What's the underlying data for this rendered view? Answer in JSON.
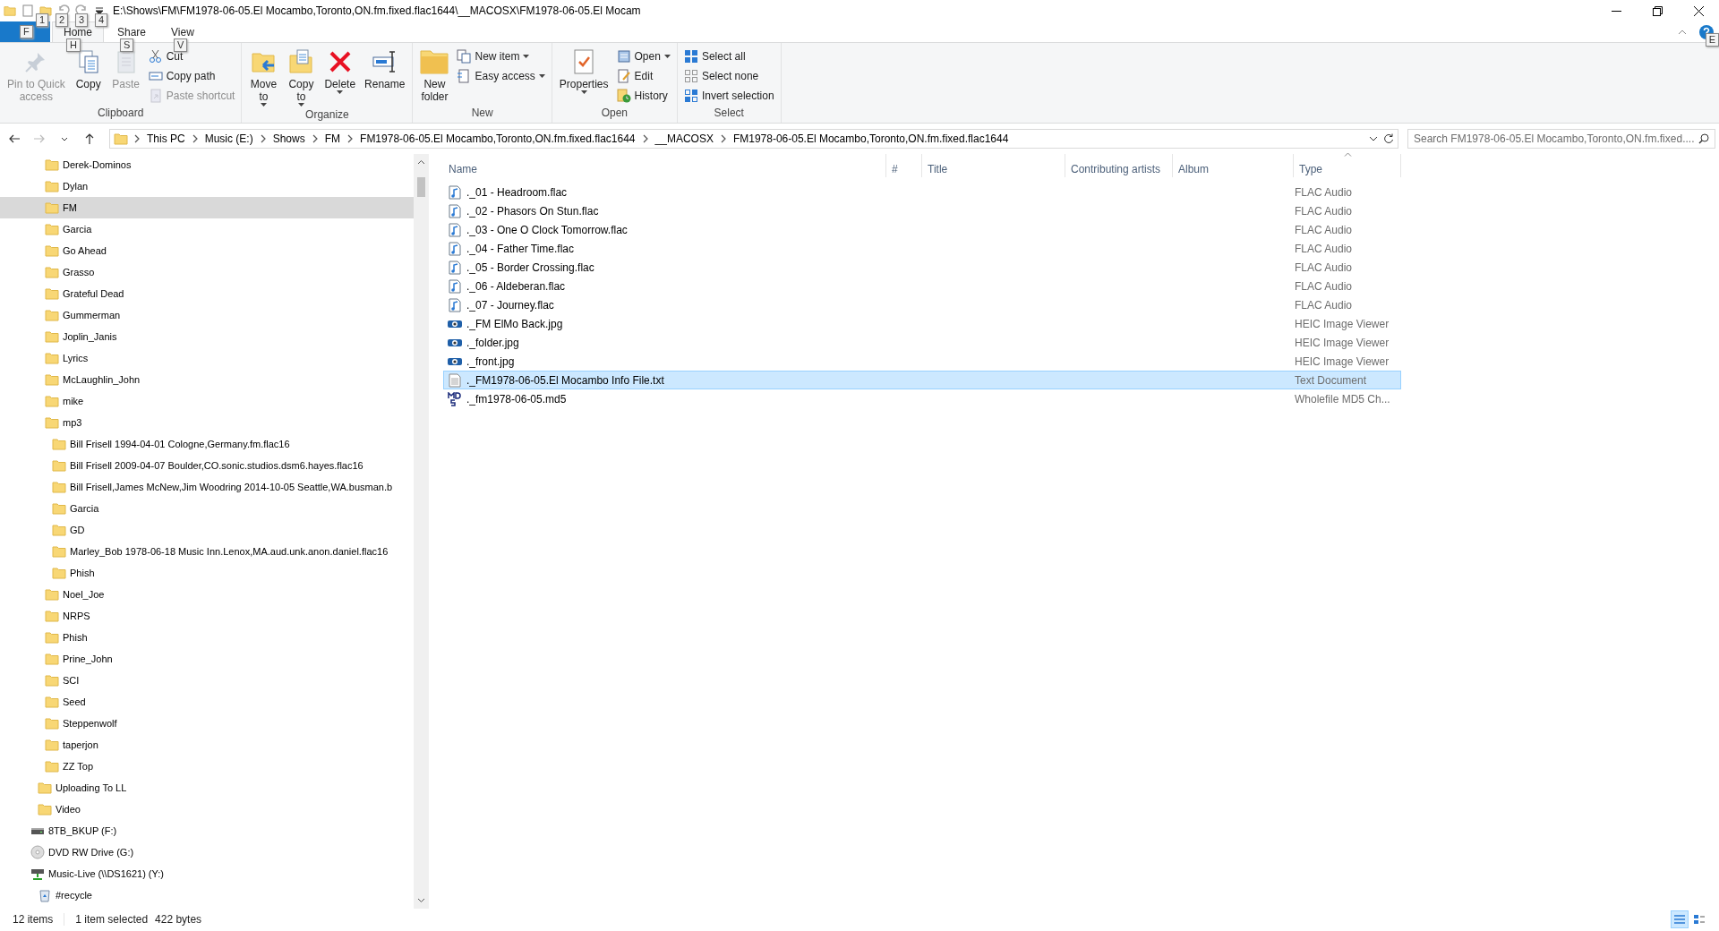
{
  "window": {
    "title": "E:\\Shows\\FM\\FM1978-06-05.El Mocambo,Toronto,ON.fm.fixed.flac1644\\__MACOSX\\FM1978-06-05.El Mocam",
    "qat_keytips": [
      "1",
      "2",
      "3",
      "4"
    ]
  },
  "ribbon_tabs": [
    {
      "keytip": "F",
      "kind": "file",
      "selected": false
    },
    {
      "label": "Home",
      "keytip": "H",
      "kind": "tab",
      "selected": true
    },
    {
      "label": "Share",
      "keytip": "S",
      "kind": "tab",
      "selected": false
    },
    {
      "label": "View",
      "keytip": "V",
      "kind": "tab",
      "selected": false
    }
  ],
  "help": {
    "keytip": "E"
  },
  "ribbon_groups": [
    {
      "label": "Clipboard",
      "items": [
        {
          "kind": "large",
          "label": "Pin to Quick\naccess",
          "disabled": true,
          "dropdown": false
        },
        {
          "kind": "large",
          "label": "Copy",
          "disabled": false,
          "dropdown": false
        },
        {
          "kind": "large",
          "label": "Paste",
          "disabled": true,
          "dropdown": false
        },
        {
          "kind": "stack",
          "items": [
            {
              "label": "Cut",
              "disabled": false,
              "dropdown": false
            },
            {
              "label": "Copy path",
              "disabled": false,
              "dropdown": false
            },
            {
              "label": "Paste shortcut",
              "disabled": true,
              "dropdown": false
            }
          ]
        }
      ]
    },
    {
      "label": "Organize",
      "items": [
        {
          "kind": "large",
          "label": "Move\nto",
          "disabled": false,
          "dropdown": true
        },
        {
          "kind": "large",
          "label": "Copy\nto",
          "disabled": false,
          "dropdown": true
        },
        {
          "kind": "large",
          "label": "Delete",
          "disabled": false,
          "dropdown": true
        },
        {
          "kind": "large",
          "label": "Rename",
          "disabled": false,
          "dropdown": false
        }
      ]
    },
    {
      "label": "New",
      "items": [
        {
          "kind": "large",
          "label": "New\nfolder",
          "disabled": false,
          "dropdown": false
        },
        {
          "kind": "stack",
          "items": [
            {
              "label": "New item",
              "disabled": false,
              "dropdown": true
            },
            {
              "label": "Easy access",
              "disabled": false,
              "dropdown": true
            }
          ]
        }
      ]
    },
    {
      "label": "Open",
      "items": [
        {
          "kind": "large",
          "label": "Properties",
          "disabled": false,
          "dropdown": true
        },
        {
          "kind": "stack",
          "items": [
            {
              "label": "Open",
              "disabled": false,
              "dropdown": true
            },
            {
              "label": "Edit",
              "disabled": false,
              "dropdown": false
            },
            {
              "label": "History",
              "disabled": false,
              "dropdown": false
            }
          ]
        }
      ]
    },
    {
      "label": "Select",
      "items": [
        {
          "kind": "stack",
          "items": [
            {
              "label": "Select all",
              "disabled": false,
              "dropdown": false
            },
            {
              "label": "Select none",
              "disabled": false,
              "dropdown": false
            },
            {
              "label": "Invert selection",
              "disabled": false,
              "dropdown": false
            }
          ]
        }
      ]
    }
  ],
  "address_bar": {
    "segments": [
      "This PC",
      "Music (E:)",
      "Shows",
      "FM",
      "FM1978-06-05.El Mocambo,Toronto,ON.fm.fixed.flac1644",
      "__MACOSX",
      "FM1978-06-05.El Mocambo,Toronto,ON.fm.fixed.flac1644"
    ]
  },
  "search": {
    "placeholder": "Search FM1978-06-05.El Mocambo,Toronto,ON.fm.fixed...."
  },
  "nav_tree": [
    {
      "children": [
        {
          "children": [
            {
              "label": "Derek-Dominos",
              "kind": "folder",
              "selected": false
            },
            {
              "label": "Dylan",
              "kind": "folder",
              "selected": false
            },
            {
              "label": "FM",
              "kind": "folder",
              "selected": true
            },
            {
              "label": "Garcia",
              "kind": "folder",
              "selected": false
            },
            {
              "label": "Go Ahead",
              "kind": "folder",
              "selected": false
            },
            {
              "label": "Grasso",
              "kind": "folder",
              "selected": false
            },
            {
              "label": "Grateful Dead",
              "kind": "folder",
              "selected": false
            },
            {
              "label": "Gummerman",
              "kind": "folder",
              "selected": false
            },
            {
              "label": "Joplin_Janis",
              "kind": "folder",
              "selected": false
            },
            {
              "label": "Lyrics",
              "kind": "folder",
              "selected": false
            },
            {
              "label": "McLaughlin_John",
              "kind": "folder",
              "selected": false
            },
            {
              "label": "mike",
              "kind": "folder",
              "selected": false
            },
            {
              "label": "mp3",
              "kind": "folder",
              "selected": false,
              "children": [
                {
                  "label": "Bill Frisell 1994-04-01 Cologne,Germany.fm.flac16",
                  "kind": "folder",
                  "selected": false
                },
                {
                  "label": "Bill Frisell 2009-04-07 Boulder,CO.sonic.studios.dsm6.hayes.flac16",
                  "kind": "folder",
                  "selected": false
                },
                {
                  "label": "Bill Frisell,James McNew,Jim Woodring 2014-10-05 Seattle,WA.busman.b",
                  "kind": "folder",
                  "selected": false
                },
                {
                  "label": "Garcia",
                  "kind": "folder",
                  "selected": false
                },
                {
                  "label": "GD",
                  "kind": "folder",
                  "selected": false
                },
                {
                  "label": "Marley_Bob 1978-06-18 Music Inn.Lenox,MA.aud.unk.anon.daniel.flac16",
                  "kind": "folder",
                  "selected": false
                },
                {
                  "label": "Phish",
                  "kind": "folder",
                  "selected": false
                }
              ]
            },
            {
              "label": "Noel_Joe",
              "kind": "folder",
              "selected": false
            },
            {
              "label": "NRPS",
              "kind": "folder",
              "selected": false
            },
            {
              "label": "Phish",
              "kind": "folder",
              "selected": false
            },
            {
              "label": "Prine_John",
              "kind": "folder",
              "selected": false
            },
            {
              "label": "SCI",
              "kind": "folder",
              "selected": false
            },
            {
              "label": "Seed",
              "kind": "folder",
              "selected": false
            },
            {
              "label": "Steppenwolf",
              "kind": "folder",
              "selected": false
            },
            {
              "label": "taperjon",
              "kind": "folder",
              "selected": false
            },
            {
              "label": "ZZ Top",
              "kind": "folder",
              "selected": false
            }
          ]
        },
        {
          "label": "Uploading To LL",
          "kind": "folder",
          "selected": false
        },
        {
          "label": "Video",
          "kind": "folder",
          "selected": false
        }
      ]
    },
    {
      "label": "8TB_BKUP (F:)",
      "kind": "drive",
      "selected": false
    },
    {
      "label": "DVD RW Drive (G:)",
      "kind": "disc",
      "selected": false
    },
    {
      "label": "Music-Live (\\\\DS1621) (Y:)",
      "kind": "network",
      "selected": false,
      "children": [
        {
          "label": "#recycle",
          "kind": "recycle",
          "selected": false
        }
      ]
    }
  ],
  "columns": [
    {
      "label": "Name",
      "sorted": false
    },
    {
      "label": "#",
      "sorted": false
    },
    {
      "label": "Title",
      "sorted": false
    },
    {
      "label": "Contributing artists",
      "sorted": false
    },
    {
      "label": "Album",
      "sorted": false
    },
    {
      "label": "Type",
      "sorted": true
    }
  ],
  "files": [
    {
      "name": "._01 - Headroom.flac",
      "type": "FLAC Audio",
      "kind": "audio",
      "selected": false
    },
    {
      "name": "._02 - Phasors On Stun.flac",
      "type": "FLAC Audio",
      "kind": "audio",
      "selected": false
    },
    {
      "name": "._03 - One O Clock Tomorrow.flac",
      "type": "FLAC Audio",
      "kind": "audio",
      "selected": false
    },
    {
      "name": "._04 - Father Time.flac",
      "type": "FLAC Audio",
      "kind": "audio",
      "selected": false
    },
    {
      "name": "._05 - Border Crossing.flac",
      "type": "FLAC Audio",
      "kind": "audio",
      "selected": false
    },
    {
      "name": "._06 - Aldeberan.flac",
      "type": "FLAC Audio",
      "kind": "audio",
      "selected": false
    },
    {
      "name": "._07 - Journey.flac",
      "type": "FLAC Audio",
      "kind": "audio",
      "selected": false
    },
    {
      "name": "._FM ElMo Back.jpg",
      "type": "HEIC Image Viewer",
      "kind": "image",
      "selected": false
    },
    {
      "name": "._folder.jpg",
      "type": "HEIC Image Viewer",
      "kind": "image",
      "selected": false
    },
    {
      "name": "._front.jpg",
      "type": "HEIC Image Viewer",
      "kind": "image",
      "selected": false
    },
    {
      "name": "._FM1978-06-05.El Mocambo Info File.txt",
      "type": "Text Document",
      "kind": "text",
      "selected": true
    },
    {
      "name": "._fm1978-06-05.md5",
      "type": "Wholefile MD5 Ch...",
      "kind": "md5",
      "selected": false
    }
  ],
  "status_bar": {
    "item_count": "12 items",
    "selection": "1 item selected",
    "size": "422 bytes",
    "views": [
      {
        "kind": "details",
        "selected": true
      },
      {
        "kind": "tiles",
        "selected": false
      }
    ]
  }
}
